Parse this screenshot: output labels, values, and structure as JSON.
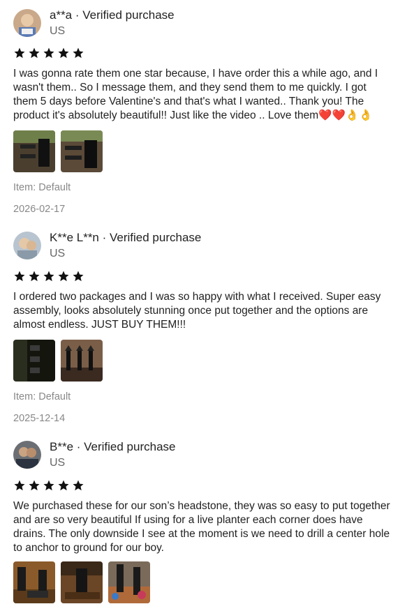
{
  "reviews": [
    {
      "name": "a**a · Verified purchase",
      "country": "US",
      "rating": 5,
      "text": "I was gonna rate them one star because, I have order this a while ago, and I wasn't them.. So I message them, and they send them to me quickly. I got them 5 days before Valentine's and that's what I wanted.. Thank you! The product it's absolutely beautiful!! Just like the video .. Love them❤️❤️👌👌",
      "item": "Item: Default",
      "date": "2026-02-17"
    },
    {
      "name": "K**e L**n · Verified purchase",
      "country": "US",
      "rating": 5,
      "text": "I ordered two packages and I was so happy with what I received. Super easy assembly, looks absolutely stunning once put together and the options are almost endless. JUST BUY THEM!!!",
      "item": "Item: Default",
      "date": "2025-12-14"
    },
    {
      "name": "B**e · Verified purchase",
      "country": "US",
      "rating": 5,
      "text": "We purchased these for our son’s headstone, they was so easy to put together and are so very beautiful If using for a live planter each corner does have drains. The only downside I see at the moment is we need to drill a center hole to anchor to ground for our boy."
    }
  ],
  "colors": {
    "star": "#111111",
    "muted": "#888888",
    "heart": "#e01b24"
  },
  "icons": {
    "star": "star-icon"
  }
}
